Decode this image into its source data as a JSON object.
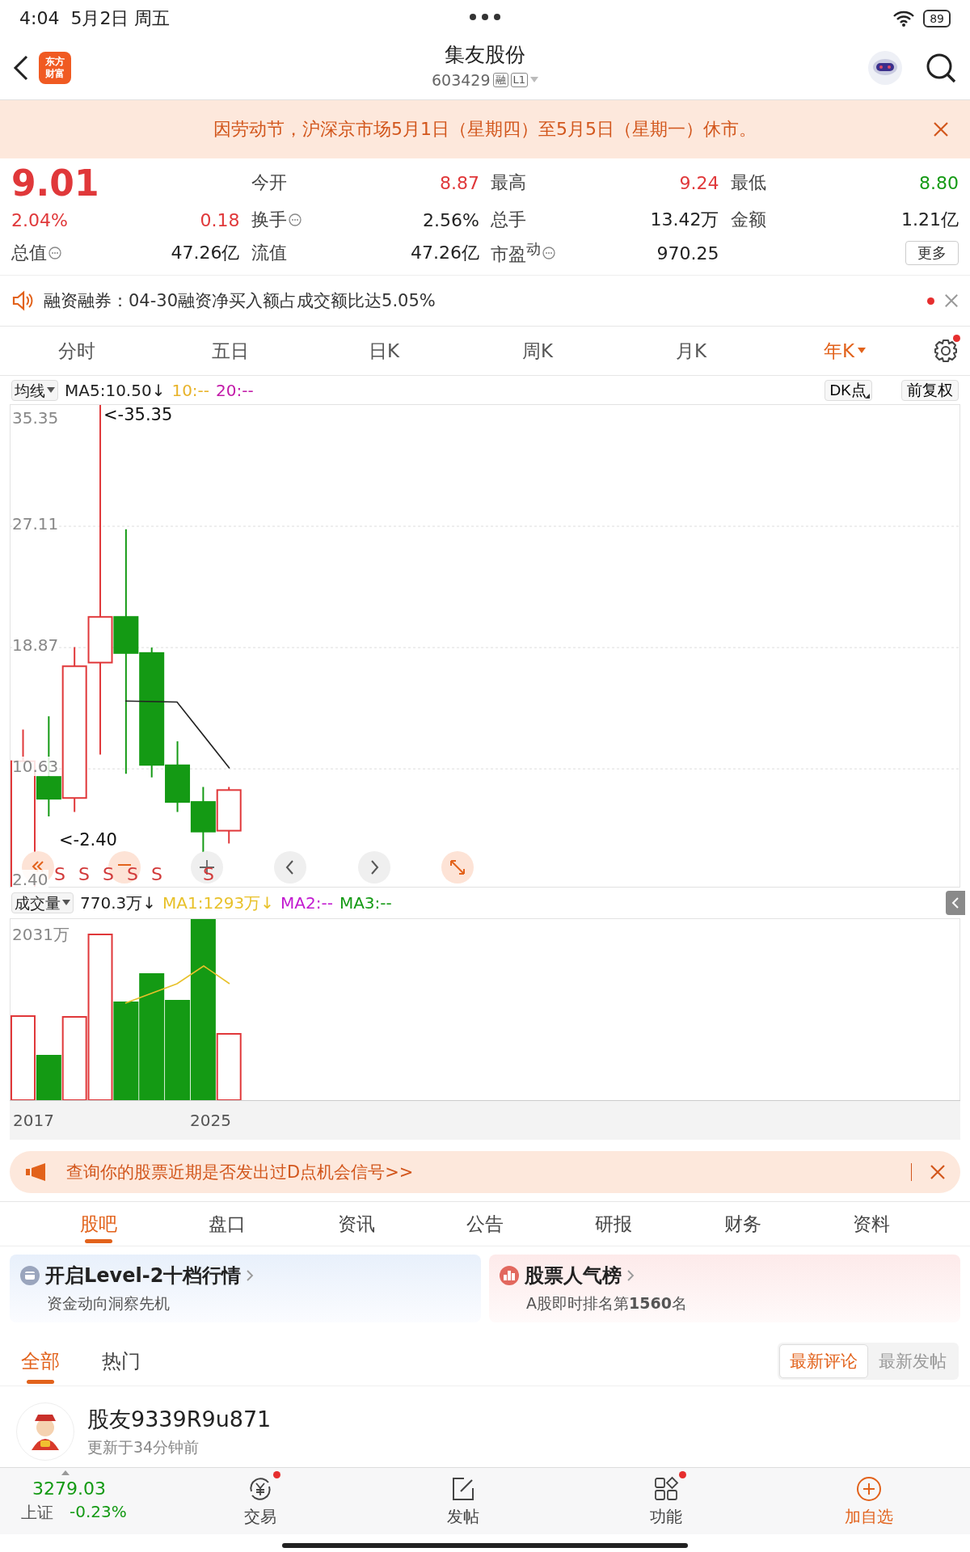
{
  "status_bar": {
    "time": "4:04",
    "date": "5月2日 周五",
    "battery": "89"
  },
  "header": {
    "logo_lines": [
      "东方",
      "财富"
    ],
    "title": "集友股份",
    "code": "603429",
    "badges": [
      "融",
      "L1"
    ]
  },
  "notice": {
    "text": "因劳动节，沪深京市场5月1日（星期四）至5月5日（星期一）休市。"
  },
  "quote": {
    "price": "9.01",
    "change_pct": "2.04%",
    "change": "0.18",
    "stats": [
      {
        "label": "今开",
        "value": "8.87",
        "color": "#e0383a",
        "info": false
      },
      {
        "label": "最高",
        "value": "9.24",
        "color": "#e0383a",
        "info": false
      },
      {
        "label": "最低",
        "value": "8.80",
        "color": "#149a14",
        "info": false
      },
      {
        "label": "换手",
        "value": "2.56%",
        "info": true
      },
      {
        "label": "总手",
        "value": "13.42万",
        "info": false
      },
      {
        "label": "金额",
        "value": "1.21亿",
        "info": false
      },
      {
        "label": "总值",
        "value": "47.26亿",
        "info": true
      },
      {
        "label": "流值",
        "value": "47.26亿",
        "info": false
      },
      {
        "label": "市盈$^{动}$",
        "value": "970.25",
        "info": true
      }
    ],
    "more": "更多"
  },
  "margin_notice": {
    "text": "融资融券：04-30融资净买入额占成交额比达5.05%",
    "unread": true
  },
  "period_tabs": [
    {
      "label": "分时",
      "selected": false
    },
    {
      "label": "五日",
      "selected": false
    },
    {
      "label": "日K",
      "selected": false
    },
    {
      "label": "周K",
      "selected": false
    },
    {
      "label": "月K",
      "selected": false
    },
    {
      "label": "年K",
      "selected": true
    }
  ],
  "settings_badge": true,
  "price_chart": {
    "indicator": "均线",
    "readings": [
      {
        "text": "MA5:10.50↓",
        "color": "#222222"
      },
      {
        "text": "10:--",
        "color": "#e8b32a"
      },
      {
        "text": "20:--",
        "color": "#c21aa8"
      }
    ],
    "buttons": [
      "DK点",
      "前复权"
    ],
    "y_labels": [
      "35.35",
      "27.11",
      "18.87",
      "10.63",
      "2.40"
    ],
    "annotations": [
      "<-35.35",
      "<-2.40"
    ],
    "markers": [
      "S",
      "S",
      "S",
      "S",
      "S",
      "S"
    ]
  },
  "volume_chart": {
    "indicator": "成交量",
    "readings": [
      {
        "text": "770.3万↓",
        "color": "#222222"
      },
      {
        "text": "MA1:1293万↓",
        "color": "#e8c12a"
      },
      {
        "text": "MA2:--",
        "color": "#c21ad0"
      },
      {
        "text": "MA3:--",
        "color": "#149a14"
      }
    ],
    "y_label": "2031万",
    "x_labels": [
      "2017",
      "2025"
    ]
  },
  "banner": {
    "text": "查询你的股票近期是否发出过D点机会信号>>"
  },
  "section_tabs": [
    {
      "label": "股吧",
      "selected": true
    },
    {
      "label": "盘口",
      "selected": false
    },
    {
      "label": "资讯",
      "selected": false
    },
    {
      "label": "公告",
      "selected": false
    },
    {
      "label": "研报",
      "selected": false
    },
    {
      "label": "财务",
      "selected": false
    },
    {
      "label": "资料",
      "selected": false
    }
  ],
  "cards": [
    {
      "kind": "level2",
      "title": "开启Level-2十档行情",
      "subtitle": "资金动向洞察先机"
    },
    {
      "kind": "ranking",
      "title": "股票人气榜",
      "subtitle": "A股即时排名第**1560**名"
    }
  ],
  "filter_tabs": [
    {
      "label": "全部",
      "selected": true
    },
    {
      "label": "热门",
      "selected": false
    }
  ],
  "sort_options": [
    {
      "label": "最新评论",
      "selected": true
    },
    {
      "label": "最新发帖",
      "selected": false
    }
  ],
  "post": {
    "user": "股友9339R9u871",
    "time": "更新于34分钟前"
  },
  "bottom_bar": {
    "index_value": "3279.03",
    "index_name": "上证",
    "index_change": "-0.23%",
    "items": [
      {
        "kind": "trade",
        "label": "交易",
        "badge": true
      },
      {
        "kind": "post",
        "label": "发帖",
        "badge": false
      },
      {
        "kind": "functions",
        "label": "功能",
        "badge": true
      },
      {
        "kind": "watch",
        "label": "加自选",
        "badge": false
      }
    ]
  }
}
